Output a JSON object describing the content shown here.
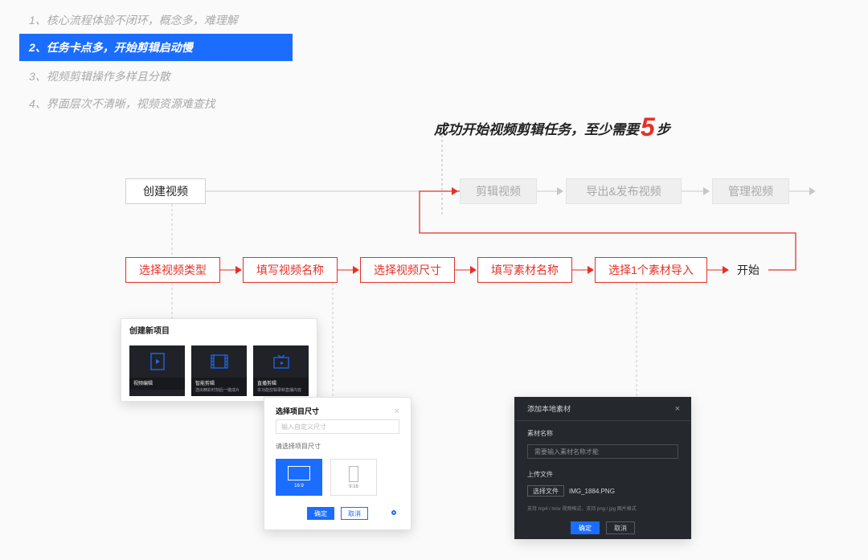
{
  "nav": {
    "items": [
      "1、核心流程体验不闭环，概念多，难理解",
      "2、任务卡点多，开始剪辑启动慢",
      "3、视频剪辑操作多样且分散",
      "4、界面层次不清晰，视频资源难查找"
    ],
    "activeIndex": 1
  },
  "headline": {
    "prefix": "成功开始视频剪辑任务，至少需要",
    "count": "5",
    "suffix": "步"
  },
  "row1": {
    "create": "创建视频",
    "edit": "剪辑视频",
    "export": "导出&发布视频",
    "manage": "管理视频"
  },
  "row2": {
    "s1": "选择视频类型",
    "s2": "填写视频名称",
    "s3": "选择视频尺寸",
    "s4": "填写素材名称",
    "s5": "选择1个素材导入",
    "start": "开始"
  },
  "panel_types": {
    "title": "创建新项目",
    "tiles": [
      {
        "label": "视频编辑",
        "sub": ""
      },
      {
        "label": "智能剪辑",
        "sub": "选出精彩时刻后一键成片"
      },
      {
        "label": "直播剪辑",
        "sub": "本功能剪辑录制直播内容"
      }
    ]
  },
  "panel_size": {
    "title": "选择项目尺寸",
    "placeholder": "输入自定义尺寸",
    "hint": "请选择项目尺寸",
    "opt1": "16:9",
    "opt2": "9:16",
    "ok": "确定",
    "cancel": "取消"
  },
  "panel_material": {
    "title": "添加本地素材",
    "nameLabel": "素材名称",
    "namePlaceholder": "需要输入素材名称才能",
    "uploadLabel": "上传文件",
    "choose": "选择文件",
    "filename": "IMG_1884.PNG",
    "helper": "支持 mp4 / mov 视频格式，支持 png / jpg 图片格式",
    "ok": "确定",
    "cancel": "取消"
  }
}
